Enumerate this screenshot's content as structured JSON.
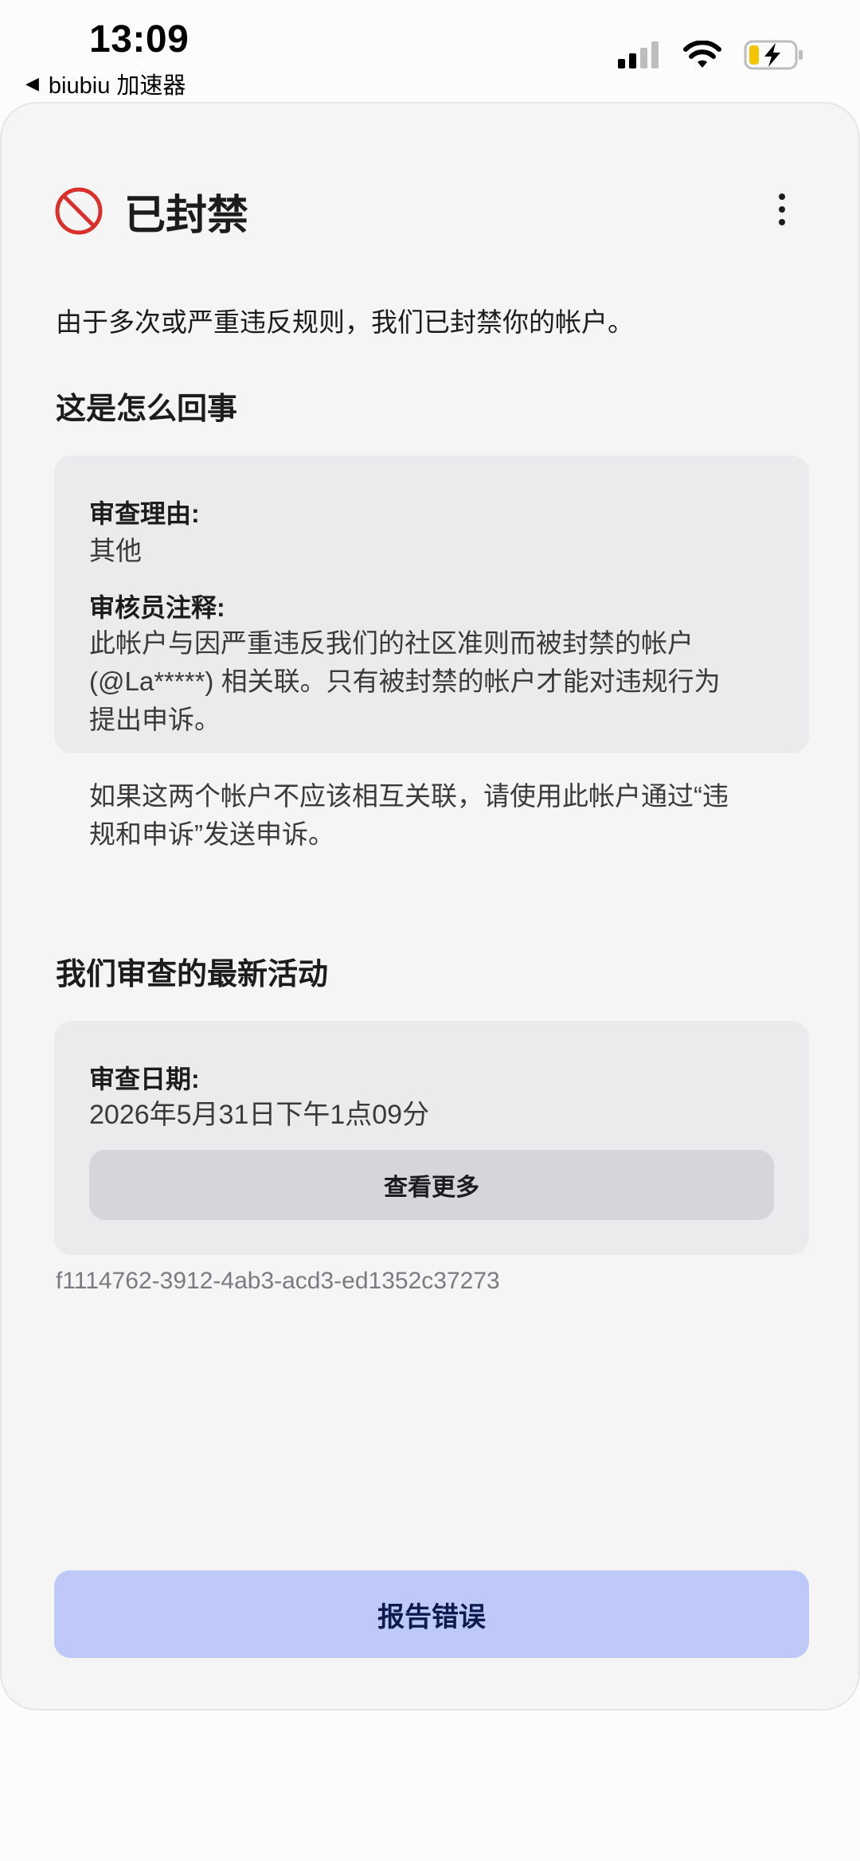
{
  "status_bar": {
    "time": "13:09",
    "back_app": "biubiu 加速器",
    "back_icon": "◀"
  },
  "header": {
    "title": "已封禁",
    "status_icon": "ban-icon",
    "menu_icon": "more-vertical-icon"
  },
  "intro": "由于多次或严重违反规则，我们已封禁你的帐户。",
  "what_happened": {
    "title": "这是怎么回事",
    "review_reason_label": "审查理由:",
    "review_reason_value": "其他",
    "reviewer_note_label": "审核员注释:",
    "reviewer_note_lines": [
      "此帐户与因严重违反我们的社区准则而被封禁的帐户",
      "(@La*****) 相关联。只有被封禁的帐户才能对违规行为",
      "提出申诉。"
    ],
    "reviewer_note_lines2": [
      "如果这两个帐户不应该相互关联，请使用此帐户通过“违",
      "规和申诉”发送申诉。"
    ]
  },
  "latest_activity": {
    "title": "我们审查的最新活动",
    "review_date_label": "审查日期:",
    "review_date_value": "2026年5月31日下午1点09分",
    "view_more_label": "查看更多"
  },
  "reference_id": "f1114762-3912-4ab3-acd3-ed1352c37273",
  "report_button_label": "报告错误",
  "colors": {
    "ban_red": "#d9302c",
    "primary_button_bg": "#bec9f7",
    "primary_button_text": "#0e1a4e",
    "card_bg": "#ebebed",
    "battery_yellow": "#f5c400"
  }
}
